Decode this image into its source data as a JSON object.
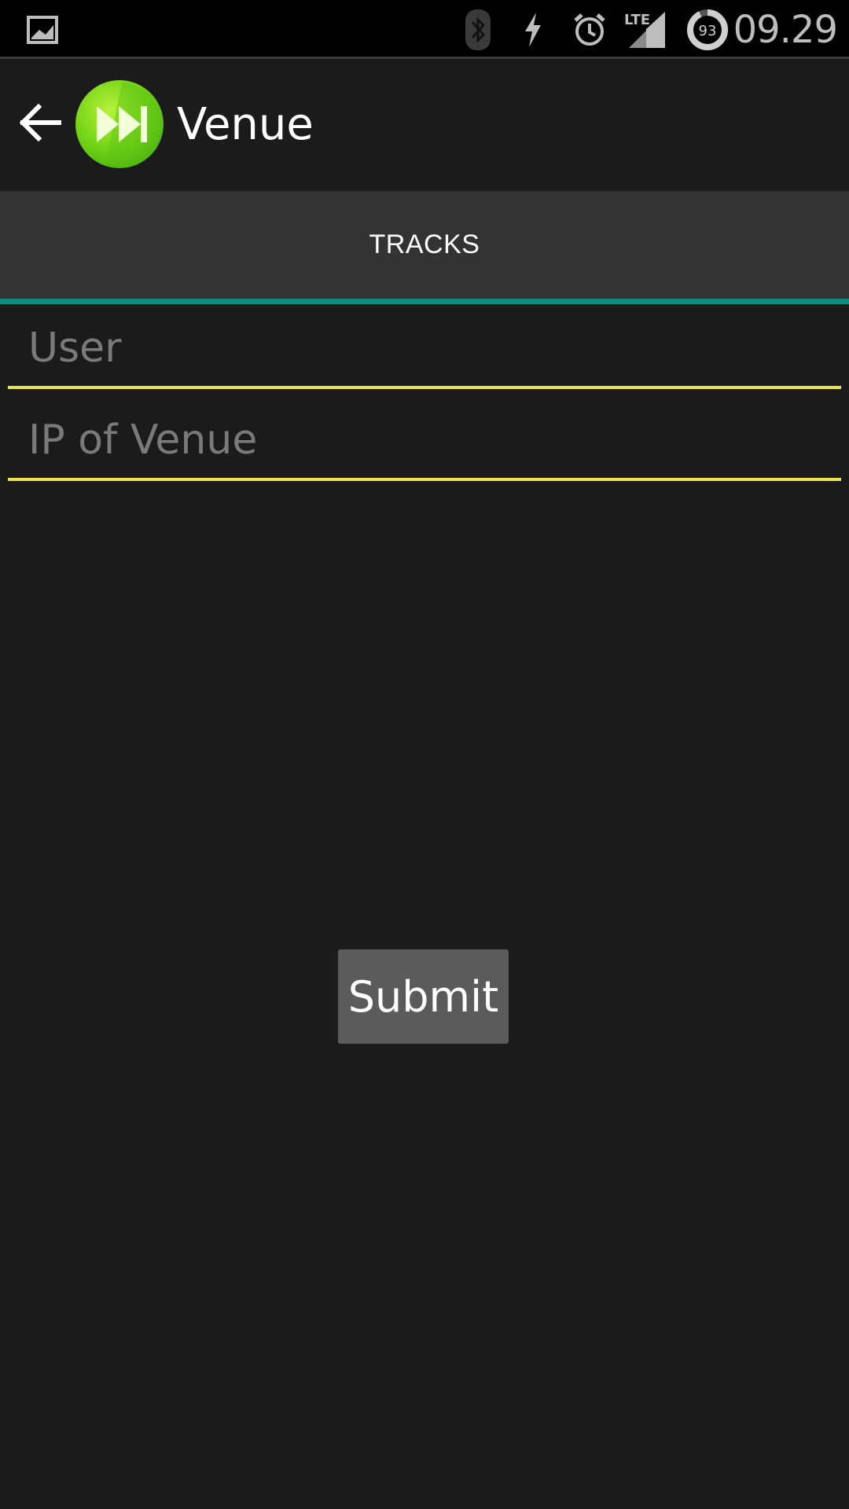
{
  "status_bar": {
    "time": "09.29",
    "battery_level": "93",
    "network": "LTE",
    "icons": [
      "gallery-icon",
      "bluetooth-icon",
      "flash-icon",
      "alarm-icon",
      "lte-signal-icon",
      "battery-icon"
    ]
  },
  "action_bar": {
    "title": "Venue",
    "back_icon": "back-arrow-icon",
    "logo_icon": "fast-forward-icon"
  },
  "tabs": [
    {
      "label": "TRACKS",
      "selected": true
    }
  ],
  "form": {
    "user": {
      "value": "",
      "placeholder": "User"
    },
    "ip": {
      "value": "",
      "placeholder": "IP of Venue"
    },
    "submit_label": "Submit"
  },
  "colors": {
    "background": "#1b1b1b",
    "status_bar": "#000000",
    "tab_strip": "#333333",
    "tab_indicator": "#0f8a7e",
    "field_underline": "#ece34a",
    "button": "#5b5b5b",
    "logo_green": "#7bd81a"
  }
}
